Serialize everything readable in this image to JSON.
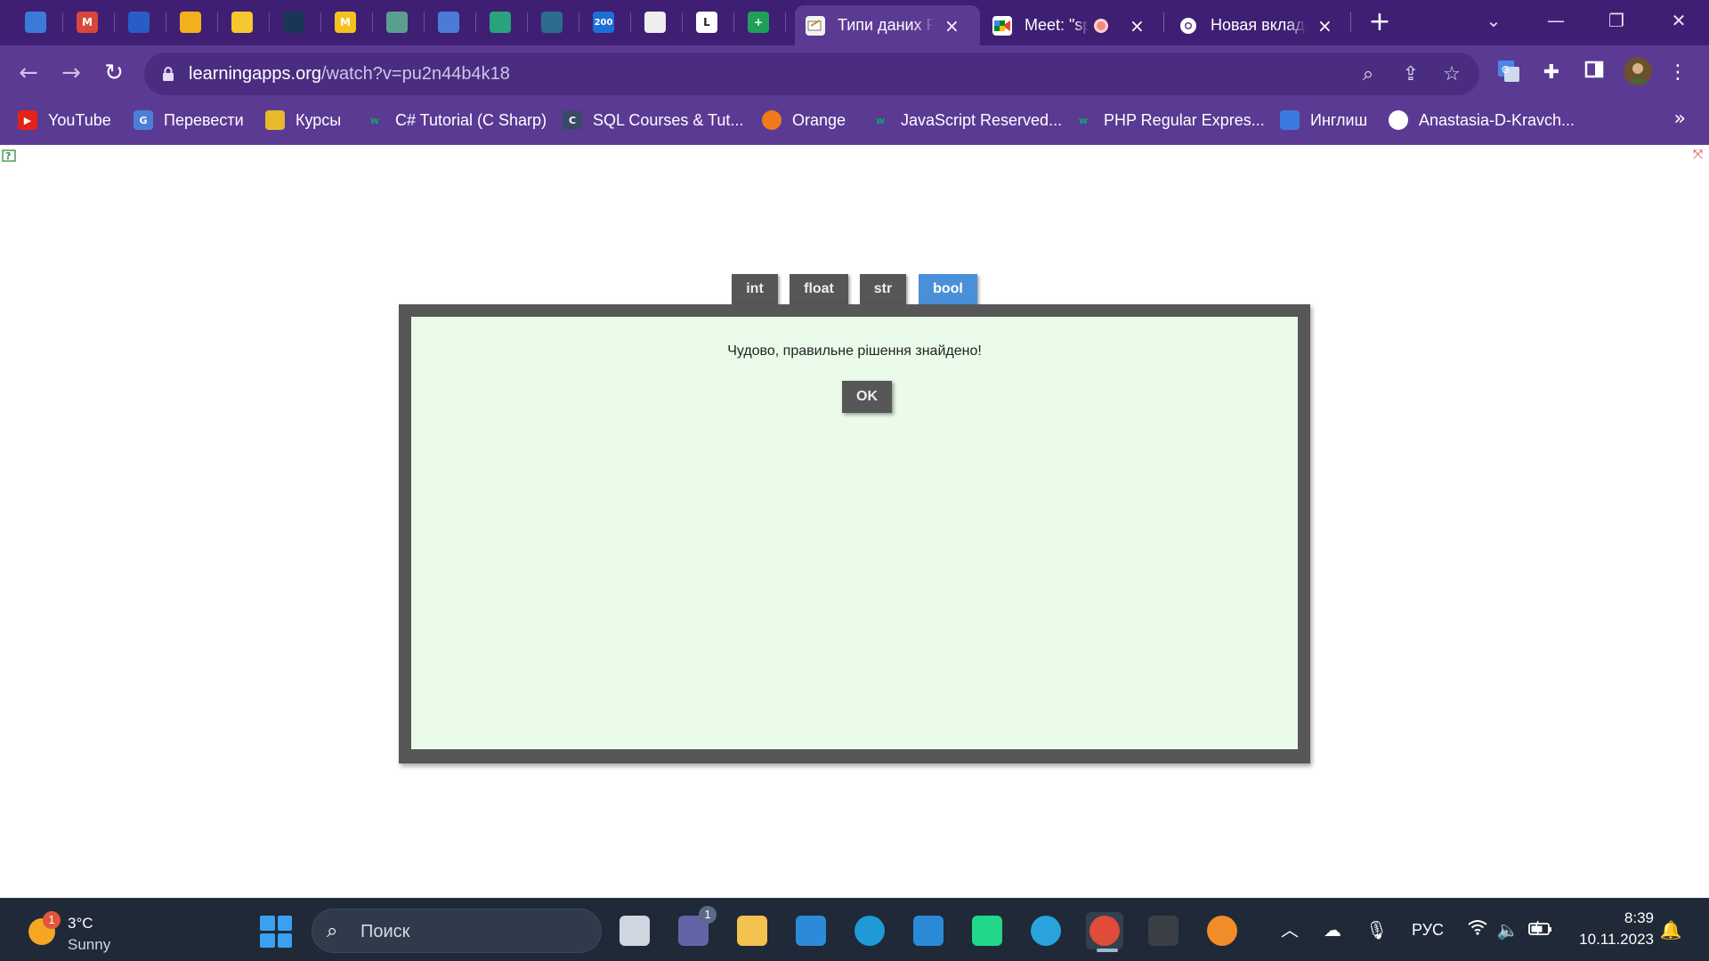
{
  "browser": {
    "tabs": [
      {
        "title": "Типи даних Python",
        "active": true,
        "favicon": "learningapps-icon",
        "close": "×"
      },
      {
        "title": "Meet: \"sp",
        "active": false,
        "favicon": "meet-icon",
        "close": "×",
        "recording": true
      },
      {
        "title": "Новая вкладка",
        "active": false,
        "favicon": "chrome-icon",
        "close": "×"
      }
    ],
    "pinned_tabs": [
      {
        "name": "classroom-icon",
        "glyph": "",
        "color": "#3b7bd8"
      },
      {
        "name": "gmail-icon",
        "glyph": "M",
        "color": "#d8473b"
      },
      {
        "name": "books-icon",
        "glyph": "",
        "color": "#2a5cc7"
      },
      {
        "name": "bell-icon",
        "glyph": "",
        "color": "#f2b11c"
      },
      {
        "name": "bulb-icon",
        "glyph": "",
        "color": "#f5c730"
      },
      {
        "name": "hexagon-icon",
        "glyph": "",
        "color": "#1b3556"
      },
      {
        "name": "m-icon",
        "glyph": "M",
        "color": "#f4c21d"
      },
      {
        "name": "chatgpt-icon",
        "glyph": "",
        "color": "#5a9f8e"
      },
      {
        "name": "lamp-icon",
        "glyph": "",
        "color": "#4b7bd6"
      },
      {
        "name": "tree-icon",
        "glyph": "",
        "color": "#2aa37c"
      },
      {
        "name": "wave-icon",
        "glyph": "",
        "color": "#2c6c8f"
      },
      {
        "name": "200-icon",
        "glyph": "200",
        "color": "#1c6fd8"
      },
      {
        "name": "face-icon",
        "glyph": "",
        "color": "#eeeeee"
      },
      {
        "name": "letter-l-icon",
        "glyph": "L",
        "color": "#ffffff"
      },
      {
        "name": "sheets-icon",
        "glyph": "+",
        "color": "#1ea05a"
      }
    ],
    "window_controls": {
      "minimize": "—",
      "restore": "❐",
      "close": "✕",
      "tab_search": "⌄"
    },
    "new_tab": "+",
    "url_host": "learningapps.org",
    "url_path": "/watch?v=pu2n44b4k18"
  },
  "bookmarks": [
    {
      "label": "YouTube",
      "icon": "youtube-icon",
      "color": "#e62117",
      "glyph": "▶"
    },
    {
      "label": "Перевести",
      "icon": "translate-icon",
      "color": "#4a7fd8",
      "glyph": "G"
    },
    {
      "label": "Курсы",
      "icon": "courses-icon",
      "color": "#e8b92b",
      "glyph": ""
    },
    {
      "label": "C# Tutorial (C Sharp)",
      "icon": "w3schools-icon",
      "color": "#04aa6d",
      "glyph": "w"
    },
    {
      "label": "SQL Courses & Tut...",
      "icon": "sql-icon",
      "color": "#3a4a66",
      "glyph": "C"
    },
    {
      "label": "Orange",
      "icon": "orange-icon",
      "color": "#f07a1a",
      "glyph": ""
    },
    {
      "label": "JavaScript Reserved...",
      "icon": "w3schools-icon",
      "color": "#04aa6d",
      "glyph": "w"
    },
    {
      "label": "PHP Regular Expres...",
      "icon": "w3schools-icon",
      "color": "#04aa6d",
      "glyph": "w"
    },
    {
      "label": "Инглиш",
      "icon": "english-icon",
      "color": "#3b7be0",
      "glyph": ""
    },
    {
      "label": "Anastasia-D-Kravch...",
      "icon": "github-icon",
      "color": "#ffffff",
      "glyph": ""
    }
  ],
  "bookmarks_more": "»",
  "app": {
    "categories": [
      {
        "label": "int",
        "active": false
      },
      {
        "label": "float",
        "active": false
      },
      {
        "label": "str",
        "active": false
      },
      {
        "label": "bool",
        "active": true
      }
    ],
    "message": "Чудово, правильне рішення знайдено!",
    "ok_label": "OK",
    "colors": {
      "board": "#575757",
      "inner": "#eafbea",
      "active_tab": "#4a90d9"
    }
  },
  "taskbar": {
    "weather_temp": "3°C",
    "weather_desc": "Sunny",
    "weather_badge": "1",
    "search_placeholder": "Поиск",
    "apps": [
      {
        "name": "task-view-icon",
        "color": "#cfd6e0"
      },
      {
        "name": "teams-icon",
        "color": "#6264a7",
        "badge": "1"
      },
      {
        "name": "file-explorer-icon",
        "color": "#f2c14e"
      },
      {
        "name": "mail-icon",
        "color": "#2b8bd8"
      },
      {
        "name": "edge-icon",
        "color": "#1f9ad6"
      },
      {
        "name": "vscode-icon",
        "color": "#2a8ad6"
      },
      {
        "name": "pycharm-icon",
        "color": "#21d789"
      },
      {
        "name": "telegram-icon",
        "color": "#2aa3dc"
      },
      {
        "name": "chrome-icon",
        "color": "#e04b3a"
      },
      {
        "name": "terminal-icon",
        "color": "#3b3f46"
      },
      {
        "name": "vpn-icon",
        "color": "#f28c28"
      }
    ],
    "language": "РУС",
    "time": "8:39",
    "date": "10.11.2023"
  }
}
